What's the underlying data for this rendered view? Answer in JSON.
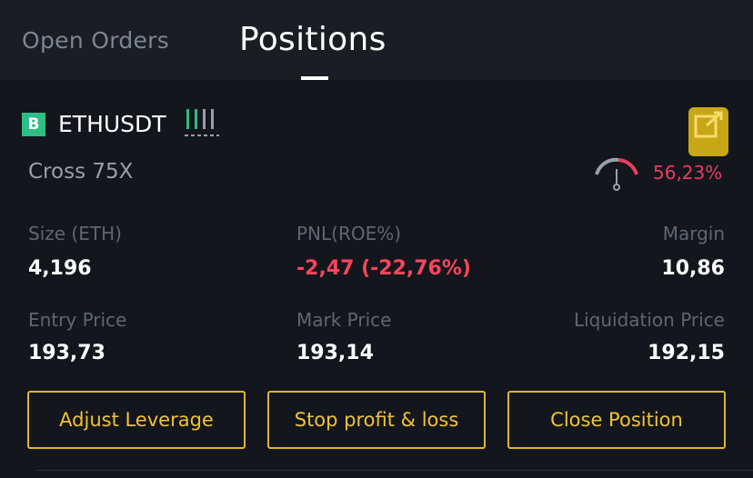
{
  "tabs": {
    "open_orders": "Open Orders",
    "positions": "Positions"
  },
  "position": {
    "side_badge": "B",
    "symbol": "ETHUSDT",
    "margin_mode": "Cross 75X",
    "margin_ratio": "56,23%",
    "size_label": "Size (ETH)",
    "size_value": "4,196",
    "pnl_label": "PNL(ROE%)",
    "pnl_value": "-2,47 (-22,76%)",
    "margin_label": "Margin",
    "margin_value": "10,86",
    "entry_label": "Entry Price",
    "entry_value": "193,73",
    "mark_label": "Mark Price",
    "mark_value": "193,14",
    "liq_label": "Liquidation Price",
    "liq_value": "192,15"
  },
  "buttons": {
    "adjust_leverage": "Adjust Leverage",
    "stop_profit_loss": "Stop profit & loss",
    "close_position": "Close Position"
  },
  "icons": {
    "bars": "bar-chart-icon",
    "gauge": "margin-ratio-gauge-icon",
    "share": "share-icon"
  },
  "colors": {
    "positive": "#2ebd85",
    "negative": "#f6465d",
    "accent": "#f0c336",
    "highlight": "#e8c018"
  }
}
